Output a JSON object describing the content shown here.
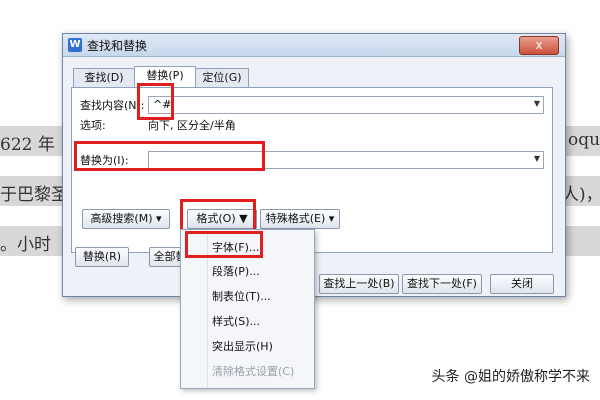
{
  "background_doc": {
    "line1_left": "622 年",
    "line1_right": "oqu",
    "line2_left": "于巴黎圣",
    "line2_right": "人)，",
    "line3_left": "。小时"
  },
  "watermark": "头条 @姐的娇傲称学不来",
  "dialog": {
    "title": "查找和替换",
    "close_label": "x",
    "tabs": [
      "查找(D)",
      "替换(P)",
      "定位(G)"
    ],
    "find_label": "查找内容(N):",
    "find_value": "^#",
    "options_label": "选项:",
    "options_value": "向下, 区分全/半角",
    "replace_label": "替换为(I):",
    "replace_value": "",
    "advanced_search": "高级搜索(M)",
    "format_button": "格式(O)",
    "special_format": "特殊格式(E)",
    "replace_button": "替换(R)",
    "replace_all_button": "全部替",
    "find_prev": "查找上一处(B)",
    "find_next": "查找下一处(F)",
    "close_button": "关闭"
  },
  "format_menu": {
    "items": [
      "字体(F)...",
      "段落(P)...",
      "制表位(T)...",
      "样式(S)...",
      "突出显示(H)",
      "清除格式设置(C)"
    ]
  },
  "colors": {
    "highlight": "#e02020",
    "accent": "#2e6fd1"
  }
}
